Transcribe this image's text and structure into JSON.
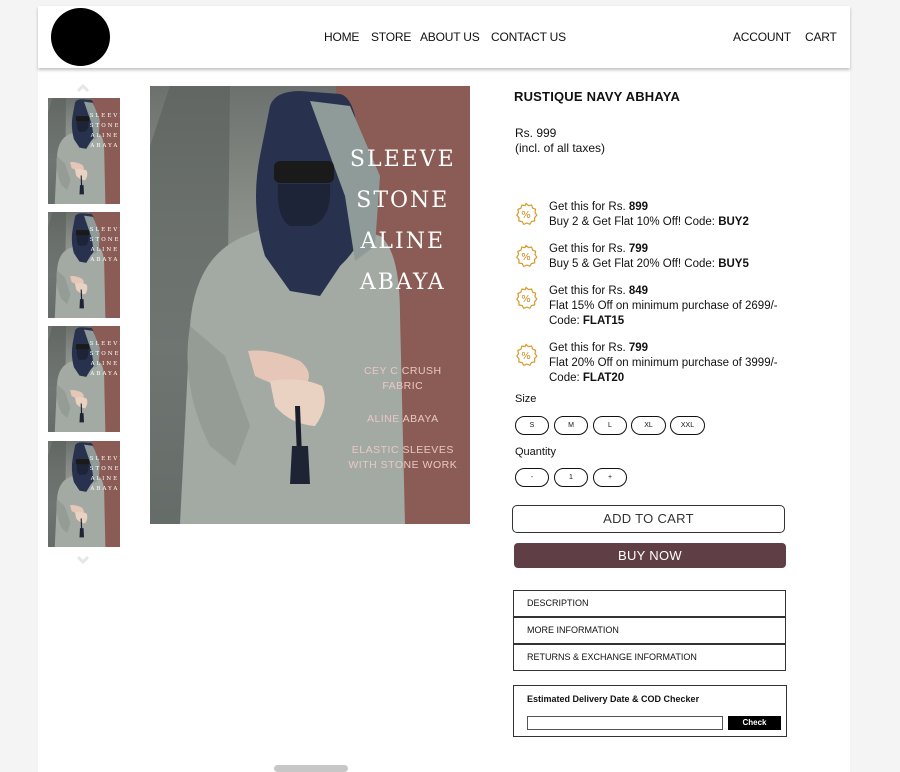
{
  "header": {
    "nav": [
      "HOME",
      "STORE",
      "ABOUT US",
      "CONTACT US"
    ],
    "account_label": "ACCOUNT",
    "cart_label": "CART"
  },
  "product": {
    "title": "RUSTIQUE NAVY ABHAYA",
    "price": "Rs. 999",
    "tax_note": "(incl. of all taxes)",
    "image_text": {
      "title_lines": [
        "SLEEVE",
        "STONE",
        "ALINE",
        "ABAYA"
      ],
      "fabric_lines": [
        "CEY C CRUSH",
        "FABRIC"
      ],
      "style_line": "ALINE ABAYA",
      "sleeve_lines": [
        "ELASTIC SLEEVES",
        "WITH STONE WORK"
      ]
    }
  },
  "offers": [
    {
      "prefix": "Get this for Rs. ",
      "price": "899",
      "desc": "Buy 2 & Get Flat 10% Off! Code: ",
      "code": "BUY2"
    },
    {
      "prefix": "Get this for Rs. ",
      "price": "799",
      "desc": "Buy 5 & Get Flat 20% Off! Code: ",
      "code": "BUY5"
    },
    {
      "prefix": "Get this for Rs. ",
      "price": "849",
      "desc": "Flat 15% Off on minimum purchase of 2699/-",
      "code_prefix": "Code: ",
      "code": "FLAT15"
    },
    {
      "prefix": "Get this for Rs. ",
      "price": "799",
      "desc": "Flat 20% Off on minimum purchase of 3999/-",
      "code_prefix": "Code: ",
      "code": "FLAT20"
    }
  ],
  "size": {
    "label": "Size",
    "options": [
      "S",
      "M",
      "L",
      "XL",
      "XXL"
    ]
  },
  "quantity": {
    "label": "Quantity",
    "minus": "-",
    "value": "1",
    "plus": "+"
  },
  "actions": {
    "add_to_cart": "ADD TO CART",
    "buy_now": "BUY NOW"
  },
  "accordion": [
    "DESCRIPTION",
    "MORE INFORMATION",
    "RETURNS & EXCHANGE INFORMATION"
  ],
  "delivery": {
    "title": "Estimated Delivery Date & COD Checker",
    "input_value": "",
    "check_label": "Check"
  },
  "icons": {
    "offer": "percent-badge-icon",
    "thumb_up": "chevron-up-icon",
    "thumb_down": "chevron-down-icon"
  },
  "colors": {
    "buy_now_bg": "#5f3e45",
    "panel": "#8b5c55",
    "badge": "#d89a2b"
  }
}
